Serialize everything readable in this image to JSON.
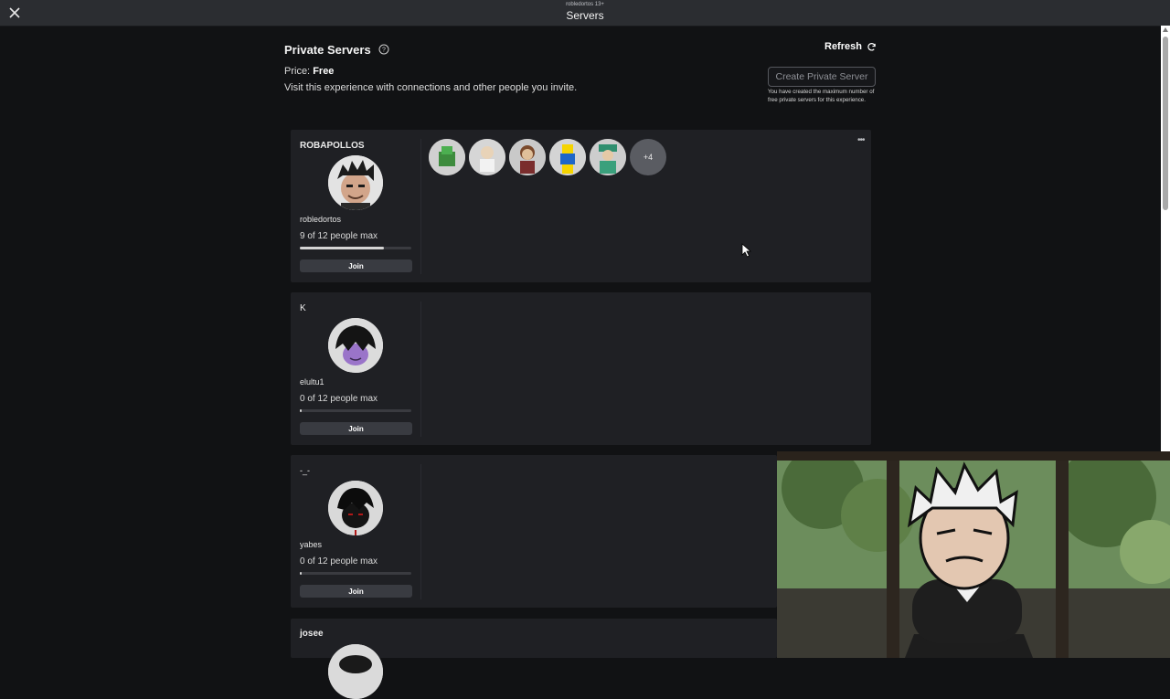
{
  "window": {
    "subtitle": "robledortos 13+",
    "title": "Servers"
  },
  "header": {
    "title": "Private Servers",
    "price_label": "Price:",
    "price_value": "Free",
    "description": "Visit this experience with connections and other people you invite.",
    "refresh_label": "Refresh",
    "create_button": "Create Private Server",
    "create_note": "You have created the maximum number of free private servers for this experience."
  },
  "servers": [
    {
      "name": "ROBAPOLLOS",
      "owner": "robledortos",
      "occupancy": "9 of 12 people max",
      "fill_fraction": 0.75,
      "join_label": "Join",
      "extra_players": "+4"
    },
    {
      "name": "K",
      "owner": "elultu1",
      "occupancy": "0 of 12 people max",
      "fill_fraction": 0.0,
      "join_label": "Join"
    },
    {
      "name": "-_-",
      "owner": "yabes",
      "occupancy": "0 of 12 people max",
      "fill_fraction": 0.0,
      "join_label": "Join"
    },
    {
      "name": "josee"
    }
  ],
  "colors": {
    "background": "#111214",
    "card": "#1f2024",
    "join_button": "#393b41"
  },
  "icons": [
    "close-icon",
    "help-icon",
    "refresh-icon",
    "more-options-icon",
    "mouse-cursor-icon"
  ]
}
